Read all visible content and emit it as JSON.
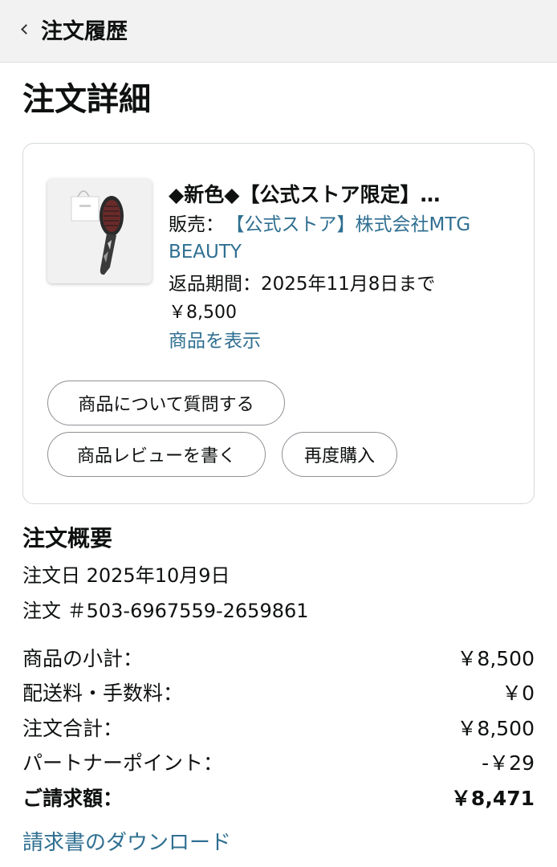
{
  "header": {
    "back_label": "注文履歴"
  },
  "page": {
    "title": "注文詳細"
  },
  "item": {
    "title": "◆新色◆【公式ストア限定】…",
    "seller_prefix": "販売：",
    "seller_name": "【公式ストア】株式会社MTG BEAUTY",
    "return_period": "返品期間：2025年11月8日まで",
    "price": "￥8,500",
    "view_product_link": "商品を表示",
    "buttons": {
      "ask_question": "商品について質問する",
      "write_review": "商品レビューを書く",
      "buy_again": "再度購入"
    }
  },
  "summary": {
    "title": "注文概要",
    "order_date": "注文日 2025年10月9日",
    "order_number": "注文 ＃503-6967559-2659861",
    "rows": [
      {
        "label": "商品の小計：",
        "value": "￥8,500"
      },
      {
        "label": "配送料・手数料：",
        "value": "￥0"
      },
      {
        "label": "注文合計：",
        "value": "￥8,500"
      },
      {
        "label": "パートナーポイント：",
        "value": "-￥29"
      },
      {
        "label": "ご請求額：",
        "value": "￥8,471"
      }
    ],
    "invoice_link": "請求書のダウンロード"
  },
  "colors": {
    "link": "#2f6f91",
    "text": "#0f1111",
    "topbar": "#f2f2f2",
    "border": "#d5d9d9"
  },
  "icons": {
    "back": "chevron-left-icon",
    "product_image": "hair-brush-with-shopping-bag"
  }
}
